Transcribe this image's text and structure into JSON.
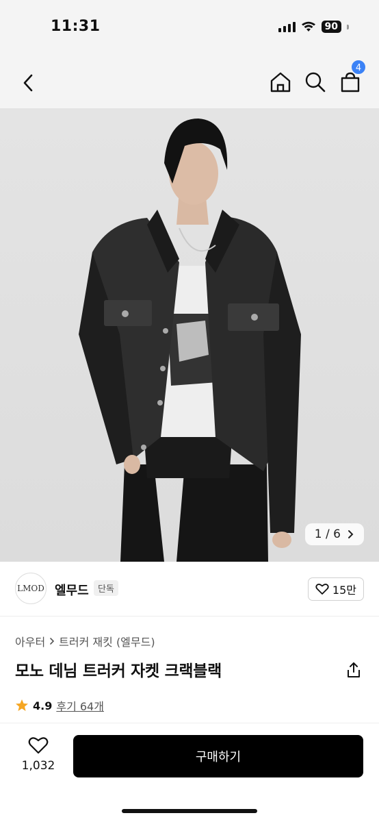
{
  "status_bar": {
    "time": "11:31",
    "battery": "90"
  },
  "nav": {
    "cart_count": "4"
  },
  "product_image": {
    "counter_current": "1",
    "counter_separator": "/",
    "counter_total": "6"
  },
  "brand": {
    "logo_text": "LMOD",
    "name": "엘무드",
    "tag": "단독",
    "likes": "15만"
  },
  "breadcrumb": {
    "category": "아우터",
    "subcategory": "트러커 재킷 (엘무드)"
  },
  "product": {
    "title": "모노 데님 트러커 자켓 크랙블랙"
  },
  "rating": {
    "score": "4.9",
    "reviews": "후기 64개"
  },
  "bottom_bar": {
    "wish_count": "1,032",
    "buy_label": "구매하기"
  },
  "colors": {
    "accent": "#3b82f6",
    "star": "#f5a623",
    "buy_bg": "#000000"
  },
  "icons": [
    "back-icon",
    "home-icon",
    "search-icon",
    "cart-icon",
    "chevron-right-icon",
    "heart-icon",
    "share-icon",
    "star-icon"
  ]
}
